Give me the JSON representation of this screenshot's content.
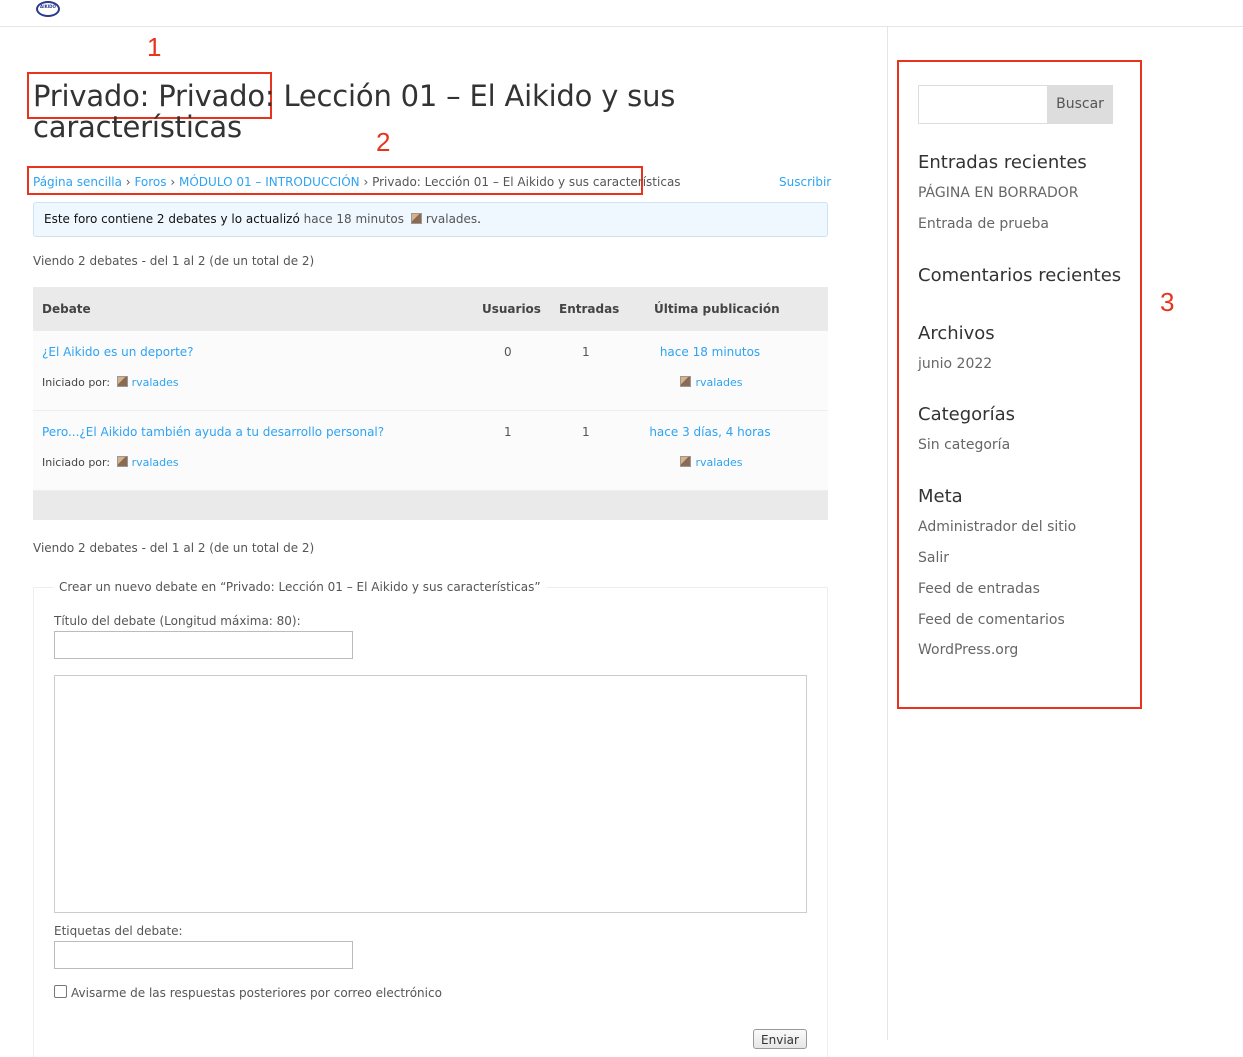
{
  "header": {
    "logo_text": "AIKIDO"
  },
  "annotations": {
    "n1": "1",
    "n2": "2",
    "n3": "3"
  },
  "page": {
    "title": "Privado: Privado: Lección 01 – El Aikido y sus características"
  },
  "breadcrumb": {
    "items": [
      "Página sencilla",
      "Foros",
      "MÓDULO 01 – INTRODUCCIÓN"
    ],
    "current": "Privado: Lección 01 – El Aikido y sus características",
    "separator": "›"
  },
  "subscribe_label": "Suscribir",
  "forum_info": {
    "text_prefix": "Este foro contiene 2 debates y lo actualizó",
    "time": "hace 18 minutos",
    "author": "rvalades",
    "suffix": "."
  },
  "pagination_text": "Viendo 2 debates - del 1 al 2 (de un total de 2)",
  "table": {
    "headers": {
      "topic": "Debate",
      "users": "Usuarios",
      "posts": "Entradas",
      "last": "Última publicación"
    },
    "started_by_label": "Iniciado por:",
    "rows": [
      {
        "title": "¿El Aikido es un deporte?",
        "author": "rvalades",
        "users": "0",
        "posts": "1",
        "freshness": "hace 18 minutos",
        "last_author": "rvalades"
      },
      {
        "title": "Pero...¿El Aikido también ayuda a tu desarrollo personal?",
        "author": "rvalades",
        "users": "1",
        "posts": "1",
        "freshness": "hace 3 días, 4 horas",
        "last_author": "rvalades"
      }
    ]
  },
  "new_topic": {
    "legend": "Crear un nuevo debate en “Privado: Lección 01 – El Aikido y sus características”",
    "title_label": "Título del debate (Longitud máxima: 80):",
    "title_value": "",
    "content_value": "",
    "tags_label": "Etiquetas del debate:",
    "tags_value": "",
    "notify_label": "Avisarme de las respuestas posteriores por correo electrónico",
    "submit_label": "Enviar"
  },
  "sidebar": {
    "search_value": "",
    "search_button": "Buscar",
    "recent_posts_title": "Entradas recientes",
    "recent_posts": [
      "PÁGINA EN BORRADOR",
      "Entrada de prueba"
    ],
    "recent_comments_title": "Comentarios recientes",
    "archives_title": "Archivos",
    "archives": [
      "junio 2022"
    ],
    "categories_title": "Categorías",
    "categories": [
      "Sin categoría"
    ],
    "meta_title": "Meta",
    "meta": [
      "Administrador del sitio",
      "Salir",
      "Feed de entradas",
      "Feed de comentarios",
      "WordPress.org"
    ]
  }
}
